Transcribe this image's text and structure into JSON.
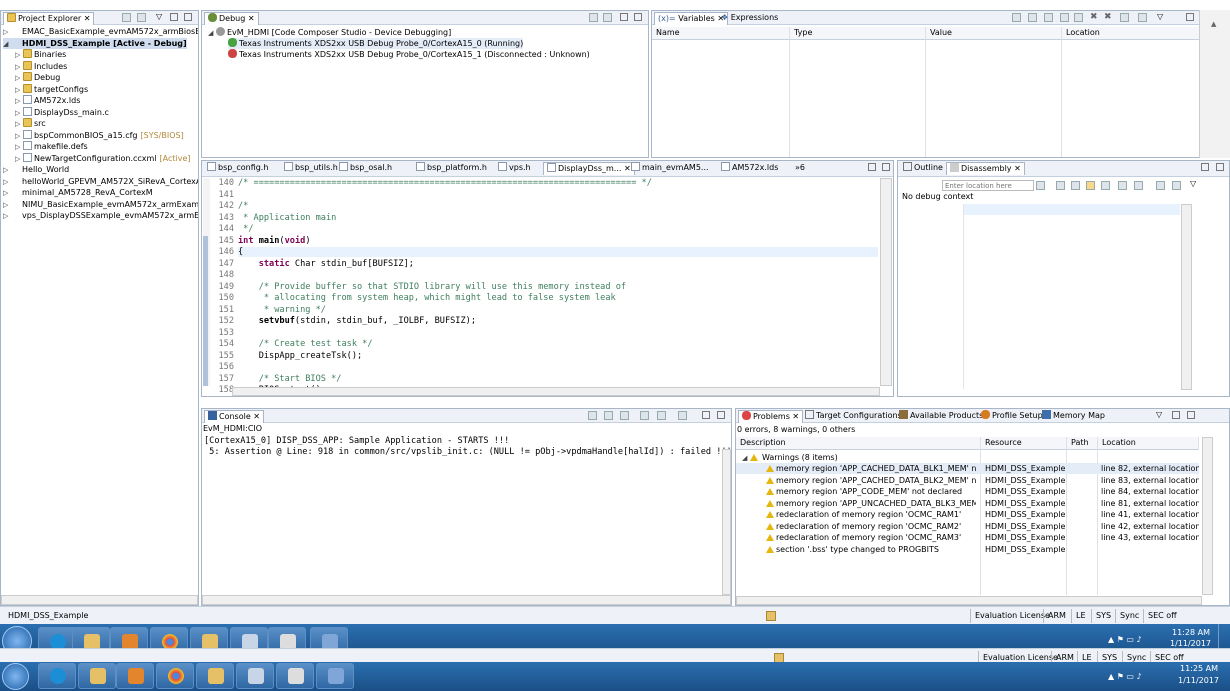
{
  "project_explorer": {
    "title": "Project Explorer",
    "items": [
      {
        "label": "EMAC_BasicExample_evmAM572x_armBiosExample",
        "decoration": "",
        "depth": 0,
        "expanded": false,
        "kind": "project",
        "selected": false
      },
      {
        "label": "HDMI_DSS_Example  [Active - Debug]",
        "decoration": "",
        "depth": 0,
        "expanded": true,
        "kind": "project",
        "selected": true
      },
      {
        "label": "Binaries",
        "decoration": "",
        "depth": 1,
        "expanded": false,
        "kind": "folder",
        "selected": false
      },
      {
        "label": "Includes",
        "decoration": "",
        "depth": 1,
        "expanded": false,
        "kind": "folder",
        "selected": false
      },
      {
        "label": "Debug",
        "decoration": "",
        "depth": 1,
        "expanded": false,
        "kind": "folder",
        "selected": false
      },
      {
        "label": "targetConfigs",
        "decoration": "",
        "depth": 1,
        "expanded": false,
        "kind": "folder",
        "selected": false
      },
      {
        "label": "AM572x.lds",
        "decoration": "",
        "depth": 1,
        "expanded": false,
        "kind": "file",
        "selected": false
      },
      {
        "label": "DisplayDss_main.c",
        "decoration": "",
        "depth": 1,
        "expanded": false,
        "kind": "file",
        "selected": false
      },
      {
        "label": "src",
        "decoration": "",
        "depth": 1,
        "expanded": false,
        "kind": "folder",
        "selected": false
      },
      {
        "label": "bspCommonBIOS_a15.cfg",
        "decoration": "[SYS/BIOS]",
        "depth": 1,
        "expanded": false,
        "kind": "file",
        "selected": false
      },
      {
        "label": "makefile.defs",
        "decoration": "",
        "depth": 1,
        "expanded": false,
        "kind": "file",
        "selected": false
      },
      {
        "label": "NewTargetConfiguration.ccxml",
        "decoration": "[Active]",
        "depth": 1,
        "expanded": false,
        "kind": "file",
        "selected": false
      },
      {
        "label": "Hello_World",
        "decoration": "",
        "depth": 0,
        "expanded": false,
        "kind": "project",
        "selected": false
      },
      {
        "label": "helloWorld_GPEVM_AM572X_SiRevA_CortexA",
        "decoration": "",
        "depth": 0,
        "expanded": false,
        "kind": "project",
        "selected": false
      },
      {
        "label": "minimal_AM5728_RevA_CortexM",
        "decoration": "",
        "depth": 0,
        "expanded": false,
        "kind": "project",
        "selected": false
      },
      {
        "label": "NIMU_BasicExample_evmAM572x_armExampleproje",
        "decoration": "",
        "depth": 0,
        "expanded": false,
        "kind": "project",
        "selected": false
      },
      {
        "label": "vps_DisplayDSSExample_evmAM572x_armExampleP",
        "decoration": "",
        "depth": 0,
        "expanded": false,
        "kind": "project",
        "selected": false
      }
    ],
    "status": "HDMI_DSS_Example"
  },
  "debug_view": {
    "title": "Debug",
    "items": [
      {
        "label": "EvM_HDMI [Code Composer Studio - Device Debugging]",
        "depth": 0
      },
      {
        "label": "Texas Instruments XDS2xx USB Debug Probe_0/CortexA15_0 (Running)",
        "depth": 1
      },
      {
        "label": "Texas Instruments XDS2xx USB Debug Probe_0/CortexA15_1 (Disconnected : Unknown)",
        "depth": 1
      }
    ]
  },
  "variables_view": {
    "tabs": [
      "Variables",
      "Expressions"
    ],
    "columns": [
      "Name",
      "Type",
      "Value",
      "Location"
    ]
  },
  "editor": {
    "tabs": [
      "bsp_config.h",
      "bsp_utils.h",
      "bsp_osal.h",
      "bsp_platform.h",
      "vps.h",
      "DisplayDss_m...",
      "main_evmAM5...",
      "AM572x.lds",
      "»6"
    ],
    "active_tab": 5,
    "lines": [
      {
        "n": "140",
        "text": "/* ========================================================================== */"
      },
      {
        "n": "141",
        "text": ""
      },
      {
        "n": "142",
        "text": "/*"
      },
      {
        "n": "143",
        "text": " * Application main"
      },
      {
        "n": "144",
        "text": " */"
      },
      {
        "n": "145",
        "text": "int main(void)"
      },
      {
        "n": "146",
        "text": "{"
      },
      {
        "n": "147",
        "text": "    static Char stdin_buf[BUFSIZ];"
      },
      {
        "n": "148",
        "text": ""
      },
      {
        "n": "149",
        "text": "    /* Provide buffer so that STDIO library will use this memory instead of"
      },
      {
        "n": "150",
        "text": "     * allocating from system heap, which might lead to false system leak"
      },
      {
        "n": "151",
        "text": "     * warning */"
      },
      {
        "n": "152",
        "text": "    setvbuf(stdin, stdin_buf, _IOLBF, BUFSIZ);"
      },
      {
        "n": "153",
        "text": ""
      },
      {
        "n": "154",
        "text": "    /* Create test task */"
      },
      {
        "n": "155",
        "text": "    DispApp_createTsk();"
      },
      {
        "n": "156",
        "text": ""
      },
      {
        "n": "157",
        "text": "    /* Start BIOS */"
      },
      {
        "n": "158",
        "text": "    BIOS_start();"
      }
    ]
  },
  "disassembly_view": {
    "tabs": [
      "Outline",
      "Disassembly"
    ],
    "location_placeholder": "Enter location here",
    "message": "No debug context"
  },
  "console_view": {
    "title": "Console",
    "subtitle": "EvM_HDMI:CIO",
    "lines": [
      "[CortexA15_0] DISP_DSS_APP: Sample Application - STARTS !!!",
      " 5: Assertion @ Line: 918 in common/src/vpslib_init.c: (NULL != pObj->vpdmaHandle[halId]) : failed !!!"
    ]
  },
  "problems_view": {
    "tabs": [
      "Problems",
      "Target Configurations",
      "Available Products",
      "Profile Setup",
      "Memory Map"
    ],
    "summary": "0 errors, 8 warnings, 0 others",
    "columns": [
      "Description",
      "Resource",
      "Path",
      "Location"
    ],
    "group_label": "Warnings (8 items)",
    "rows": [
      {
        "description": "memory region 'APP_CACHED_DATA_BLK1_MEM' not declared",
        "resource": "HDMI_DSS_Example",
        "path": "",
        "location": "line 82, external location: c:\\ti"
      },
      {
        "description": "memory region 'APP_CACHED_DATA_BLK2_MEM' not declared",
        "resource": "HDMI_DSS_Example",
        "path": "",
        "location": "line 83, external location: c:\\ti"
      },
      {
        "description": "memory region 'APP_CODE_MEM' not declared",
        "resource": "HDMI_DSS_Example",
        "path": "",
        "location": "line 84, external location: c:\\ti"
      },
      {
        "description": "memory region 'APP_UNCACHED_DATA_BLK3_MEM' not declared",
        "resource": "HDMI_DSS_Example",
        "path": "",
        "location": "line 81, external location: c:\\ti"
      },
      {
        "description": "redeclaration of memory region 'OCMC_RAM1'",
        "resource": "HDMI_DSS_Example",
        "path": "",
        "location": "line 41, external location: c:\\ti"
      },
      {
        "description": "redeclaration of memory region 'OCMC_RAM2'",
        "resource": "HDMI_DSS_Example",
        "path": "",
        "location": "line 42, external location: c:\\ti"
      },
      {
        "description": "redeclaration of memory region 'OCMC_RAM3'",
        "resource": "HDMI_DSS_Example",
        "path": "",
        "location": "line 43, external location: c:\\ti"
      },
      {
        "description": "section '.bss' type changed to PROGBITS",
        "resource": "HDMI_DSS_Example",
        "path": "",
        "location": ""
      }
    ]
  },
  "status_bar": {
    "segments": [
      "Evaluation License",
      "ARM",
      "LE",
      "SYS",
      "Sync",
      "SEC off"
    ]
  },
  "taskbar": {
    "time": "11:28 AM",
    "date": "1/11/2017",
    "icons": [
      "start-orb-icon",
      "internet-explorer-icon",
      "file-explorer-icon",
      "media-player-icon",
      "chrome-icon",
      "folder-icon",
      "paint-icon",
      "cube-icon",
      "network-icon"
    ]
  },
  "taskbar2": {
    "time": "11:25 AM",
    "date": "1/11/2017"
  },
  "status_bar2": {
    "segments": [
      "Evaluation License",
      "ARM",
      "LE",
      "SYS",
      "Sync",
      "SEC off"
    ]
  }
}
